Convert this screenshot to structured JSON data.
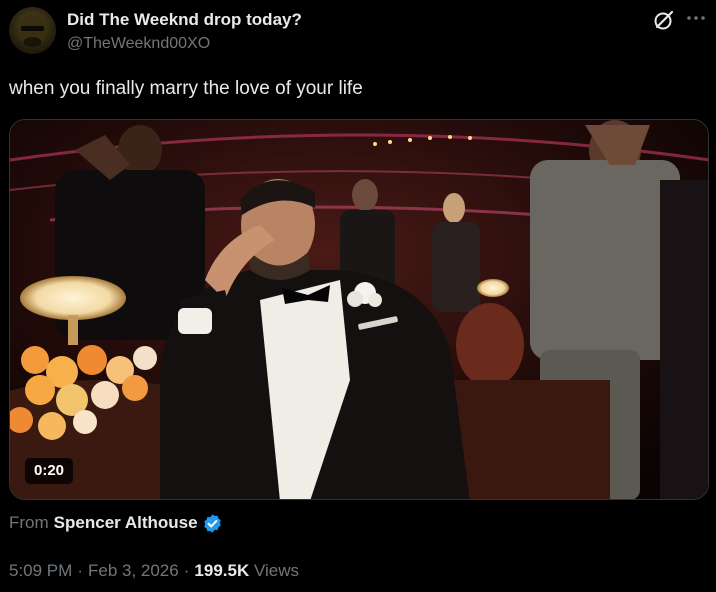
{
  "tweet": {
    "display_name": "Did The Weeknd drop today?",
    "handle": "@TheWeeknd00XO",
    "text": "when you finally marry the love of your life",
    "media": {
      "duration": "0:20"
    },
    "from_label": "From",
    "from_name": "Spencer Althouse",
    "time": "5:09 PM",
    "separator": "·",
    "date": "Feb 3, 2026",
    "views_count": "199.5K",
    "views_label": "Views"
  },
  "icons": {
    "grok": "grok-icon",
    "more": "more-icon",
    "verified": "verified-badge-icon"
  },
  "colors": {
    "background": "#000000",
    "primary_text": "#e7e9ea",
    "secondary_text": "#71767b",
    "verified_blue": "#1d9bf0"
  }
}
